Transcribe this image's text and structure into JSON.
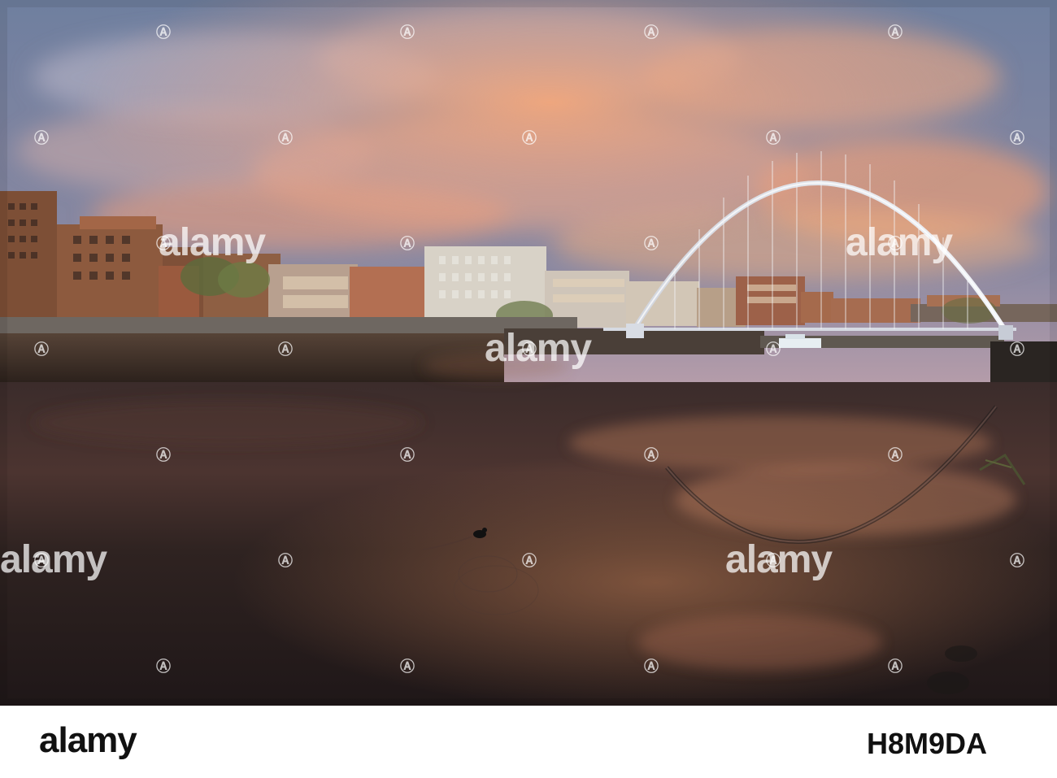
{
  "image": {
    "alt": "",
    "colors": {
      "sky_top": "#6f7f9f",
      "sky_mid": "#c8a5ad",
      "sky_glow": "#f3a176",
      "water_dark": "#24191a",
      "water_warm": "#b57a5d",
      "building_brick": "#8d5a3e",
      "building_light": "#d8d2c7",
      "bridge": "#e6e8ee"
    }
  },
  "watermark": {
    "text": "alamy"
  },
  "footer": {
    "brand": "alamy",
    "image_id": "H8M9DA"
  }
}
